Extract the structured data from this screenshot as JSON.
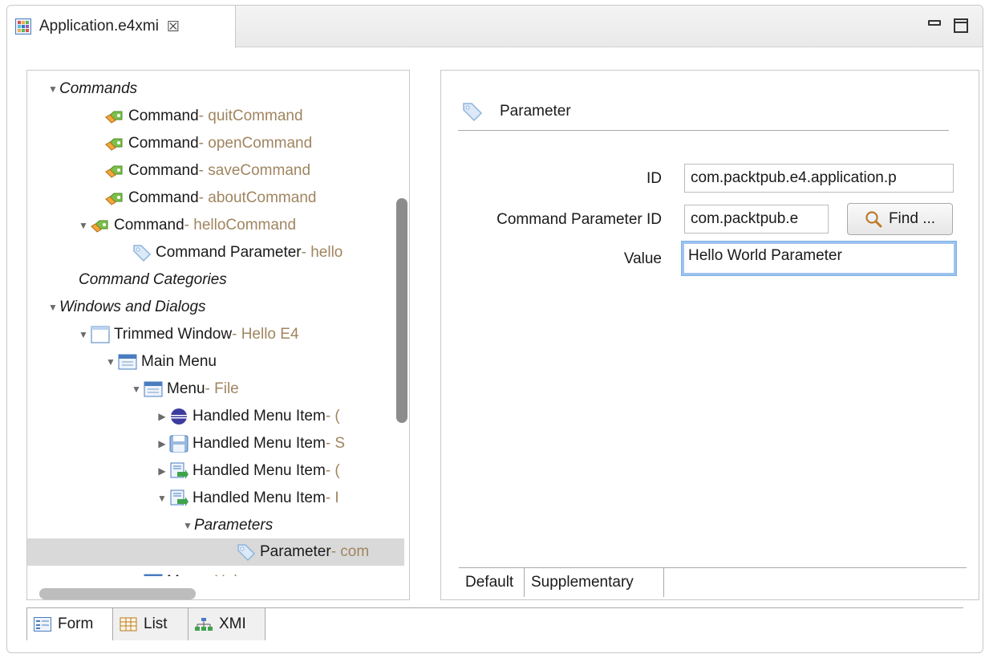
{
  "editor": {
    "tab_title": "Application.e4xmi",
    "close_glyph": "☒"
  },
  "tree": {
    "rows": [
      {
        "label": "Commands",
        "suffix": "",
        "icon": "folder-category",
        "italic": true,
        "twisty": "expanded"
      },
      {
        "label": "Command",
        "suffix": "quitCommand",
        "icon": "command-icon"
      },
      {
        "label": "Command",
        "suffix": "openCommand",
        "icon": "command-icon"
      },
      {
        "label": "Command",
        "suffix": "saveCommand",
        "icon": "command-icon"
      },
      {
        "label": "Command",
        "suffix": "aboutCommand",
        "icon": "command-icon"
      },
      {
        "label": "Command",
        "suffix": "helloCommand",
        "icon": "command-icon",
        "twisty": "expanded"
      },
      {
        "label": "Command Parameter",
        "suffix": "hello",
        "icon": "parameter-tag-icon"
      },
      {
        "label": "Command Categories",
        "suffix": "",
        "italic": true
      },
      {
        "label": "Windows and Dialogs",
        "suffix": "",
        "italic": true,
        "twisty": "expanded"
      },
      {
        "label": "Trimmed Window",
        "suffix": "Hello E4",
        "icon": "window-icon",
        "twisty": "expanded"
      },
      {
        "label": "Main Menu",
        "suffix": "",
        "icon": "menu-icon",
        "twisty": "expanded"
      },
      {
        "label": "Menu",
        "suffix": "File",
        "icon": "menu-icon",
        "twisty": "expanded"
      },
      {
        "label": "Handled Menu Item",
        "suffix": "(",
        "icon": "eclipse-icon",
        "twisty": "collapsed"
      },
      {
        "label": "Handled Menu Item",
        "suffix": "S",
        "icon": "save-icon",
        "twisty": "collapsed"
      },
      {
        "label": "Handled Menu Item",
        "suffix": "(",
        "icon": "handled-item-icon",
        "twisty": "collapsed"
      },
      {
        "label": "Handled Menu Item",
        "suffix": "I",
        "icon": "handled-item-icon",
        "twisty": "expanded"
      },
      {
        "label": "Parameters",
        "suffix": "",
        "italic": true,
        "twisty": "expanded"
      },
      {
        "label": "Parameter",
        "suffix": "com",
        "icon": "parameter-tag-icon",
        "selected": true
      },
      {
        "label": "Menu",
        "suffix": "Help",
        "icon": "menu-icon",
        "twisty": "collapsed"
      }
    ],
    "separator": " - "
  },
  "detail": {
    "title": "Parameter",
    "id_label": "ID",
    "id_value": "com.packtpub.e4.application.p",
    "cmd_param_label": "Command Parameter ID",
    "cmd_param_value": "com.packtpub.e",
    "find_label": "Find ...",
    "value_label": "Value",
    "value_value": "Hello World Parameter",
    "subtabs": [
      "Default",
      "Supplementary"
    ]
  },
  "page_tabs": [
    "Form",
    "List",
    "XMI"
  ]
}
